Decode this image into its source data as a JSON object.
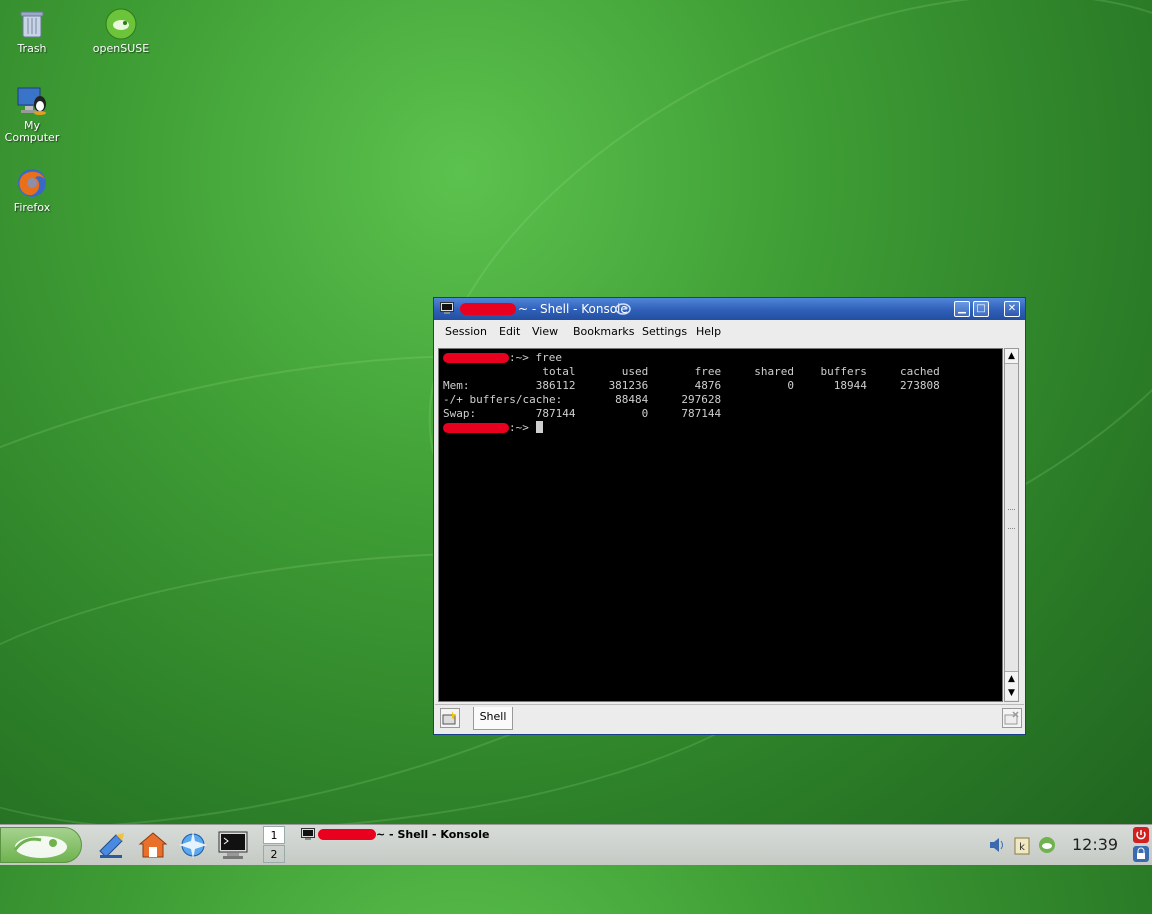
{
  "desktop": {
    "icons": [
      {
        "label": "Trash",
        "icon": "trash-icon"
      },
      {
        "label": "openSUSE",
        "icon": "opensuse-icon"
      },
      {
        "label": "My\nComputer",
        "icon": "my-computer-icon"
      },
      {
        "label": "Firefox",
        "icon": "firefox-icon"
      }
    ]
  },
  "window": {
    "title_suffix": "~ - Shell - Konsole",
    "menu": [
      "Session",
      "Edit",
      "View",
      "Bookmarks",
      "Settings",
      "Help"
    ],
    "terminal": {
      "command": ":~> free",
      "lines": [
        "               total       used       free     shared    buffers     cached",
        "Mem:          386112     381236       4876          0      18944     273808",
        "-/+ buffers/cache:        88484     297628",
        "Swap:         787144          0     787144"
      ],
      "prompt": ":~> "
    },
    "tab_label": "Shell"
  },
  "taskbar": {
    "pager": [
      "1",
      "2"
    ],
    "task_title_suffix": "~ - Shell - Konsole",
    "clock": "12:39"
  },
  "colors": {
    "desktop_green": "#3f9e35",
    "titlebar_blue": "#2f5fb8",
    "redaction_red": "#e8001e"
  }
}
